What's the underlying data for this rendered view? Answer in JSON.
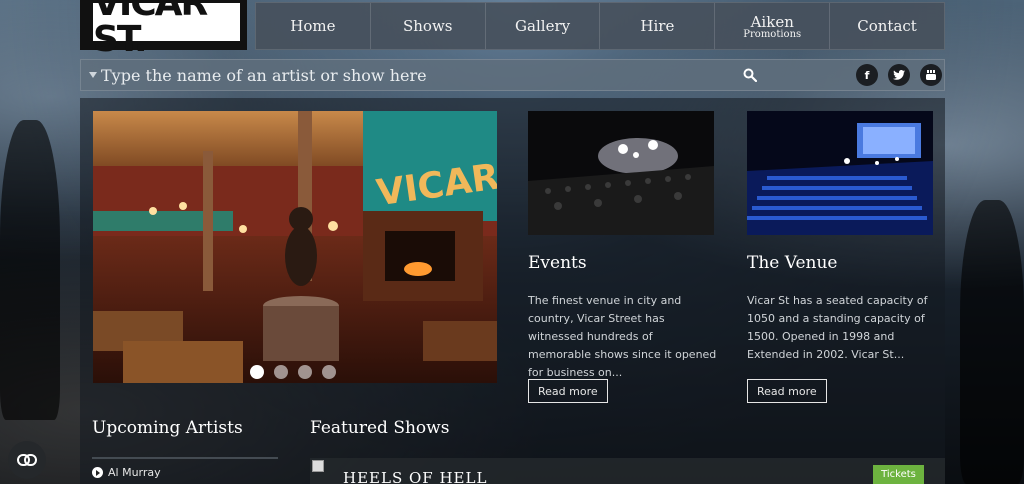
{
  "logo": {
    "text": "VICAR ST."
  },
  "nav": {
    "items": [
      {
        "label": "Home"
      },
      {
        "label": "Shows"
      },
      {
        "label": "Gallery"
      },
      {
        "label": "Hire"
      },
      {
        "label": "Aiken",
        "sublabel": "Promotions"
      },
      {
        "label": "Contact"
      }
    ]
  },
  "search": {
    "placeholder": "Type the name of an artist or show here",
    "icon": "search-icon"
  },
  "social": [
    {
      "icon": "facebook-icon",
      "glyph": "f"
    },
    {
      "icon": "twitter-icon",
      "glyph": "t"
    },
    {
      "icon": "youtube-icon",
      "glyph": "You\nTube"
    }
  ],
  "slider": {
    "sign_text": "VICAR",
    "slide_count": 4,
    "active_slide": 1
  },
  "cards": [
    {
      "title": "Events",
      "text": "The finest venue in city and country, Vicar Street has witnessed hundreds of memorable shows since it opened for business on...",
      "button": "Read more"
    },
    {
      "title": "The Venue",
      "text": "Vicar St has a seated capacity of 1050 and a standing capacity of 1500. Opened in 1998 and Extended in 2002. Vicar St...",
      "button": "Read more"
    }
  ],
  "upcoming": {
    "title": "Upcoming Artists",
    "items": [
      "Al Murray"
    ]
  },
  "featured": {
    "title": "Featured Shows",
    "show_title": "HEELS OF HELL",
    "tickets_label": "Tickets",
    "tickets_color": "#6db33f"
  },
  "colors": {
    "nav_bg": "#46505c",
    "search_bg": "#5f6e7c",
    "accent": "#6db33f"
  }
}
